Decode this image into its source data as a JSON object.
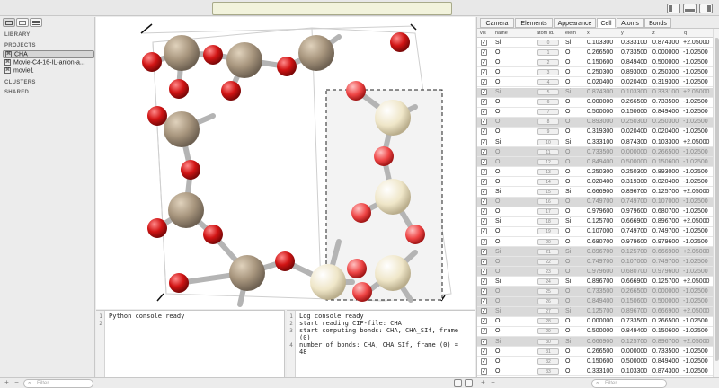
{
  "window": {
    "title_field": ""
  },
  "toolbar": {
    "left_icons": [
      "sidebar-layout-icon",
      "folder-icon",
      "list-icon"
    ],
    "right_icons": [
      "left-panel-icon",
      "bottom-panel-icon",
      "right-panel-icon"
    ]
  },
  "sidebar": {
    "library_label": "LIBRARY",
    "projects_label": "PROJECTS",
    "clusters_label": "CLUSTERS",
    "shared_label": "SHARED",
    "projects": [
      {
        "name": "CHA",
        "selected": true
      },
      {
        "name": "Movie-C4-16-IL-anion-a...",
        "selected": false
      },
      {
        "name": "movie1",
        "selected": false
      }
    ]
  },
  "python_console": {
    "lines": [
      "Python console ready",
      ""
    ]
  },
  "log_console": {
    "lines": [
      "Log console ready",
      "start reading CIF-file: CHA",
      "start computing bonds: CHA, CHA_SIf, frame (0)",
      "number of bonds: CHA, CHA_SIf, frame (0) = 48"
    ],
    "display": [
      "Log console ready",
      "start reading CIF-file: CHA",
      "start computing bonds: CHA, CHA_SIf, frame",
      "(0)",
      "number of bonds: CHA, CHA_SIf, frame (0) =",
      "48"
    ]
  },
  "tabs": [
    "Camera",
    "Elements",
    "Appearance",
    "Cell",
    "Atoms",
    "Bonds"
  ],
  "active_tab": "Cell",
  "table": {
    "columns": [
      "vis",
      "name",
      "atom id.",
      "elem",
      "x",
      "y",
      "z",
      "q"
    ],
    "rows": [
      [
        "Si",
        "0",
        "Si",
        "0.103300",
        "0.333100",
        "0.874300",
        "+2.05000"
      ],
      [
        "O",
        "1",
        "O",
        "0.266500",
        "0.733500",
        "0.000000",
        "-1.02500"
      ],
      [
        "O",
        "2",
        "O",
        "0.150600",
        "0.849400",
        "0.500000",
        "-1.02500"
      ],
      [
        "O",
        "3",
        "O",
        "0.250300",
        "0.893000",
        "0.250300",
        "-1.02500"
      ],
      [
        "O",
        "4",
        "O",
        "0.020400",
        "0.020400",
        "0.319300",
        "-1.02500"
      ],
      [
        "Si",
        "5",
        "Si",
        "0.874300",
        "0.103300",
        "0.333100",
        "+2.05000"
      ],
      [
        "O",
        "6",
        "O",
        "0.000000",
        "0.266500",
        "0.733500",
        "-1.02500"
      ],
      [
        "O",
        "7",
        "O",
        "0.500000",
        "0.150600",
        "0.849400",
        "-1.02500"
      ],
      [
        "O",
        "8",
        "O",
        "0.893000",
        "0.250300",
        "0.250300",
        "-1.02500"
      ],
      [
        "O",
        "9",
        "O",
        "0.319300",
        "0.020400",
        "0.020400",
        "-1.02500"
      ],
      [
        "Si",
        "10",
        "Si",
        "0.333100",
        "0.874300",
        "0.103300",
        "+2.05000"
      ],
      [
        "O",
        "11",
        "O",
        "0.733500",
        "0.000000",
        "0.266500",
        "-1.02500"
      ],
      [
        "O",
        "12",
        "O",
        "0.849400",
        "0.500000",
        "0.150600",
        "-1.02500"
      ],
      [
        "O",
        "13",
        "O",
        "0.250300",
        "0.250300",
        "0.893000",
        "-1.02500"
      ],
      [
        "O",
        "14",
        "O",
        "0.020400",
        "0.319300",
        "0.020400",
        "-1.02500"
      ],
      [
        "Si",
        "15",
        "Si",
        "0.666900",
        "0.896700",
        "0.125700",
        "+2.05000"
      ],
      [
        "O",
        "16",
        "O",
        "0.749700",
        "0.749700",
        "0.107000",
        "-1.02500"
      ],
      [
        "O",
        "17",
        "O",
        "0.979600",
        "0.979600",
        "0.680700",
        "-1.02500"
      ],
      [
        "Si",
        "18",
        "Si",
        "0.125700",
        "0.666900",
        "0.896700",
        "+2.05000"
      ],
      [
        "O",
        "19",
        "O",
        "0.107000",
        "0.749700",
        "0.749700",
        "-1.02500"
      ],
      [
        "O",
        "20",
        "O",
        "0.680700",
        "0.979600",
        "0.979600",
        "-1.02500"
      ],
      [
        "Si",
        "21",
        "Si",
        "0.896700",
        "0.125700",
        "0.666900",
        "+2.05000"
      ],
      [
        "O",
        "22",
        "O",
        "0.749700",
        "0.107000",
        "0.749700",
        "-1.02500"
      ],
      [
        "O",
        "23",
        "O",
        "0.979600",
        "0.680700",
        "0.979600",
        "-1.02500"
      ],
      [
        "Si",
        "24",
        "Si",
        "0.896700",
        "0.666900",
        "0.125700",
        "+2.05000"
      ],
      [
        "O",
        "25",
        "O",
        "0.733500",
        "0.266500",
        "0.000000",
        "-1.02500"
      ],
      [
        "O",
        "26",
        "O",
        "0.849400",
        "0.150600",
        "0.500000",
        "-1.02500"
      ],
      [
        "Si",
        "27",
        "Si",
        "0.125700",
        "0.896700",
        "0.666900",
        "+2.05000"
      ],
      [
        "O",
        "28",
        "O",
        "0.000000",
        "0.733500",
        "0.266500",
        "-1.02500"
      ],
      [
        "O",
        "29",
        "O",
        "0.500000",
        "0.849400",
        "0.150600",
        "-1.02500"
      ],
      [
        "Si",
        "30",
        "Si",
        "0.666900",
        "0.125700",
        "0.896700",
        "+2.05000"
      ],
      [
        "O",
        "31",
        "O",
        "0.266500",
        "0.000000",
        "0.733500",
        "-1.02500"
      ],
      [
        "O",
        "32",
        "O",
        "0.150600",
        "0.500000",
        "0.849400",
        "-1.02500"
      ],
      [
        "O",
        "33",
        "O",
        "0.333100",
        "0.103300",
        "0.874300",
        "-1.02500"
      ]
    ],
    "greyed_rows": [
      5,
      8,
      11,
      12,
      16,
      21,
      22,
      23,
      25,
      26,
      27,
      30
    ]
  },
  "filters": {
    "left_placeholder": "Filter",
    "right_placeholder": "Filter"
  },
  "colors": {
    "silicon": "#a8967e",
    "oxygen": "#d11414",
    "selected_atom": "#efe6c8",
    "bond": "#b4b4b4"
  }
}
